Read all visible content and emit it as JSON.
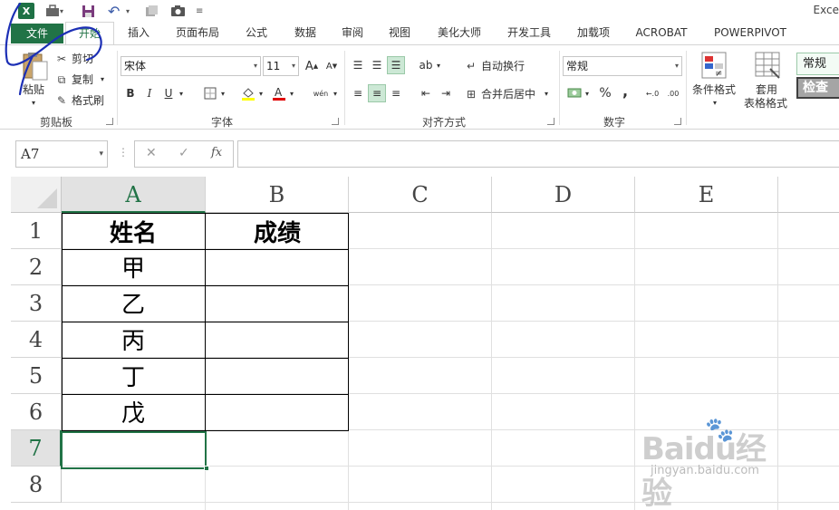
{
  "app": {
    "title": "Exce"
  },
  "qat": {
    "icons": [
      "excel-logo",
      "briefcase-icon",
      "save-icon",
      "undo-icon",
      "repeat-icon",
      "camera-icon",
      "customize-icon"
    ],
    "excel_letter": "X"
  },
  "tabs": [
    "文件",
    "开始",
    "插入",
    "页面布局",
    "公式",
    "数据",
    "审阅",
    "视图",
    "美化大师",
    "开发工具",
    "加载项",
    "ACROBAT",
    "POWERPIVOT"
  ],
  "ribbon": {
    "clipboard": {
      "paste": "粘贴",
      "cut": "剪切",
      "copy": "复制",
      "format_painter": "格式刷",
      "label": "剪贴板"
    },
    "font": {
      "name": "宋体",
      "size": "11",
      "bold": "B",
      "italic": "I",
      "underline": "U",
      "label": "字体",
      "grow": "A",
      "shrink": "A",
      "phonetic": "wén"
    },
    "alignment": {
      "wrap": "自动换行",
      "merge": "合并后居中",
      "label": "对齐方式"
    },
    "number": {
      "format": "常规",
      "percent": "%",
      "comma": ",",
      "label": "数字"
    },
    "styles": {
      "conditional": "条件格式",
      "table_format_1": "套用",
      "table_format_2": "表格格式",
      "style_normal": "常规",
      "style_check": "检查"
    }
  },
  "formula_bar": {
    "name_box": "A7",
    "fx": "fx",
    "cancel": "✕",
    "enter": "✓",
    "value": ""
  },
  "sheet": {
    "columns": [
      "A",
      "B",
      "C",
      "D",
      "E"
    ],
    "rows": [
      "1",
      "2",
      "3",
      "4",
      "5",
      "6",
      "7",
      "8"
    ],
    "cells": {
      "A1": "姓名",
      "B1": "成绩",
      "A2": "甲",
      "A3": "乙",
      "A4": "丙",
      "A5": "丁",
      "A6": "戊"
    }
  },
  "watermark": {
    "main": "Baidu经验",
    "sub": "jingyan.baidu.com"
  },
  "colors": {
    "excel_green": "#217346",
    "selected_header": "#e2e2e2",
    "align_selected": "#cce8d5"
  }
}
